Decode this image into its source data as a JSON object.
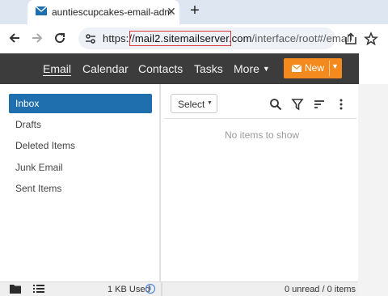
{
  "browser": {
    "tab_title": "auntiescupcakes-email-administ",
    "tab_close": "✕",
    "new_tab": "+",
    "url_scheme": "https://",
    "url_host": "mail2.sitemailserver.com",
    "url_path": "/interface/root#/email"
  },
  "nav": {
    "items": [
      "Email",
      "Calendar",
      "Contacts",
      "Tasks",
      "More"
    ],
    "new_label": "New"
  },
  "folders": [
    "Inbox",
    "Drafts",
    "Deleted Items",
    "Junk Email",
    "Sent Items"
  ],
  "list": {
    "select_label": "Select",
    "empty_text": "No items to show"
  },
  "status": {
    "used": "1 KB Used",
    "info": "i",
    "count": "0 unread / 0 items"
  },
  "colors": {
    "accent_blue": "#1f6eae",
    "new_orange": "#f48a1e",
    "header_dark": "#3c3c3c",
    "highlight_red": "#d63a3a"
  }
}
